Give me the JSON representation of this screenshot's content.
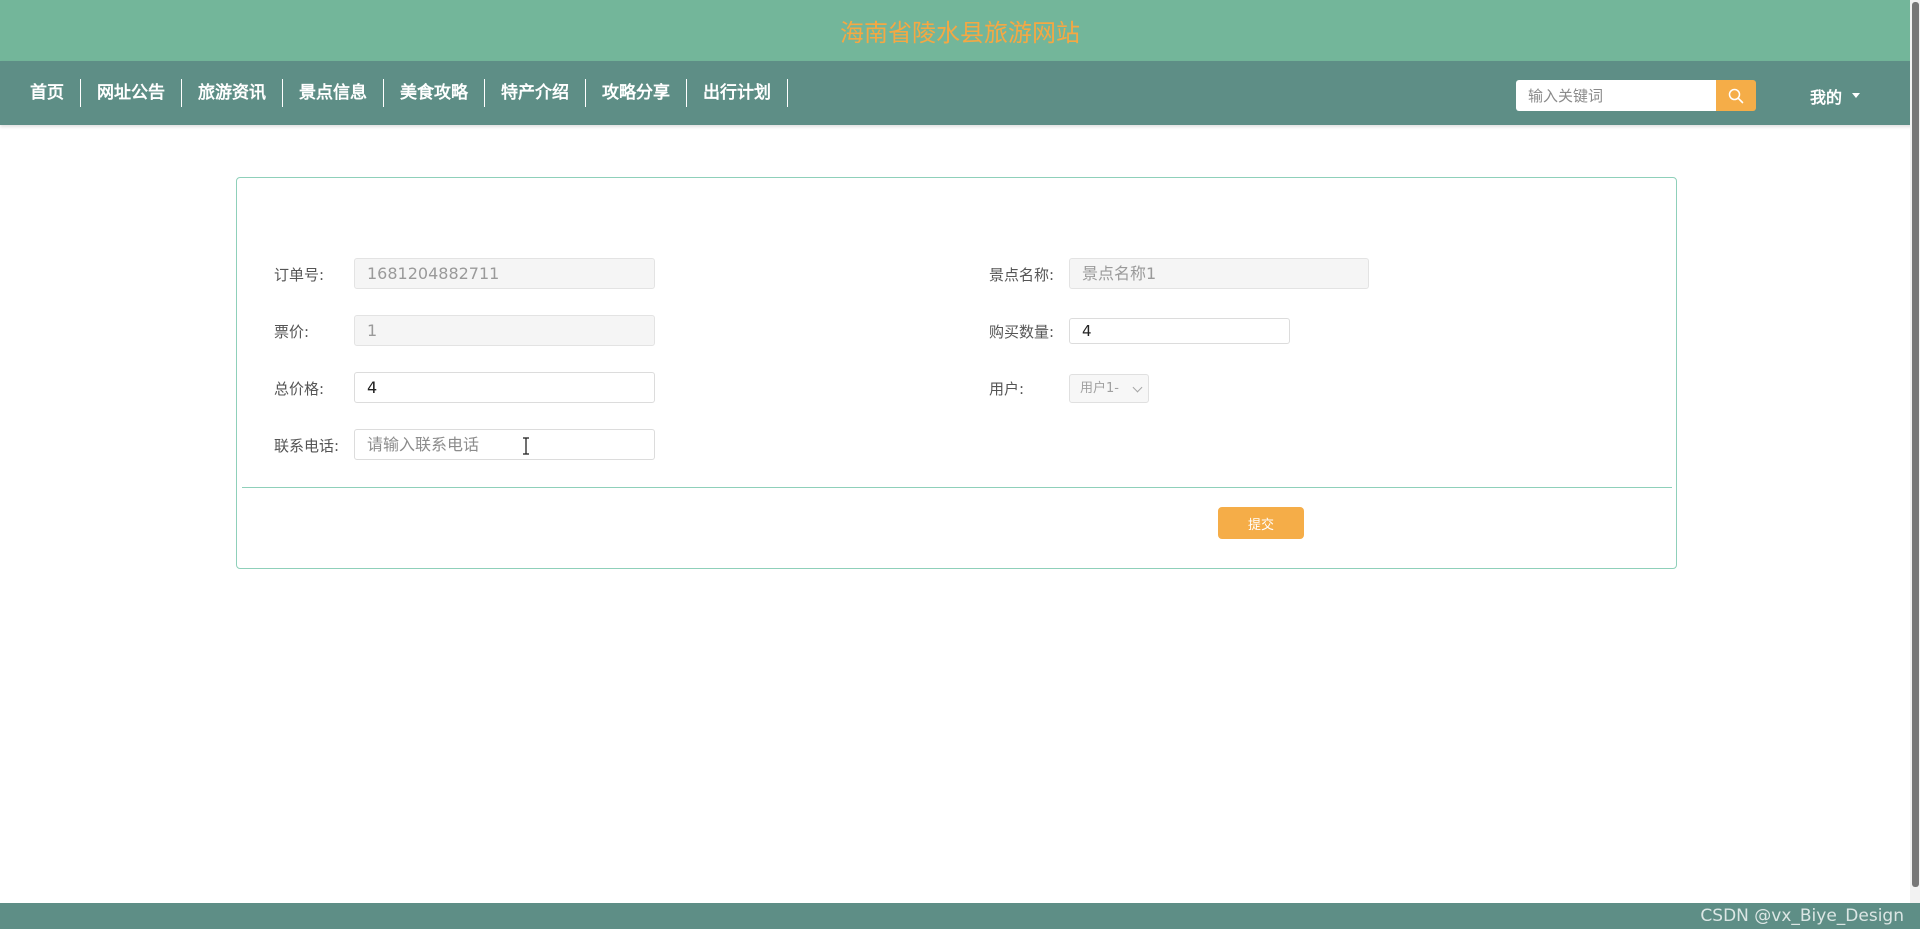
{
  "header": {
    "site_title": "海南省陵水县旅游网站"
  },
  "nav": {
    "items": [
      {
        "label": "首页"
      },
      {
        "label": "网址公告"
      },
      {
        "label": "旅游资讯"
      },
      {
        "label": "景点信息"
      },
      {
        "label": "美食攻略"
      },
      {
        "label": "特产介绍"
      },
      {
        "label": "攻略分享"
      },
      {
        "label": "出行计划"
      }
    ],
    "search_placeholder": "输入关键词",
    "search_icon": "search-icon",
    "user_menu_label": "我的"
  },
  "form": {
    "order_no": {
      "label": "订单号:",
      "value": "1681204882711"
    },
    "scenic_name": {
      "label": "景点名称:",
      "value": "景点名称1"
    },
    "ticket_price": {
      "label": "票价:",
      "value": "1"
    },
    "quantity": {
      "label": "购买数量:",
      "value": "4"
    },
    "total_price": {
      "label": "总价格:",
      "value": "4"
    },
    "user": {
      "label": "用户:",
      "value": "用户1-"
    },
    "phone": {
      "label": "联系电话:",
      "placeholder": "请输入联系电话"
    },
    "submit_label": "提交"
  },
  "footer": {
    "watermark": "CSDN @vx_Biye_Design"
  },
  "colors": {
    "title_bar": "#73b69a",
    "nav_bar": "#5e8e86",
    "accent": "#f5ad48",
    "title_text": "#f5a843",
    "card_border": "#8fd0ba"
  }
}
